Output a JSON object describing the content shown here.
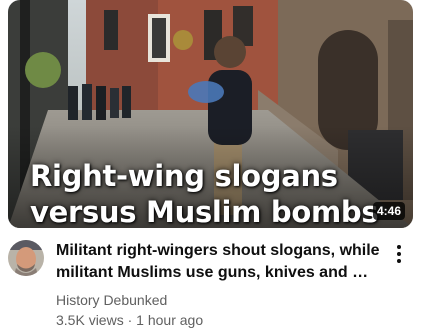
{
  "video": {
    "thumbnail_overlay_line1": "Right-wing slogans",
    "thumbnail_overlay_line2": "versus Muslim bombs",
    "duration": "4:46",
    "title": "Militant right-wingers shout slogans, while militant Muslims use guns, knives and …",
    "channel": "History Debunked",
    "views": "3.5K views",
    "separator": " · ",
    "age": "1 hour ago",
    "menu_icon": "more-vert-icon"
  },
  "colors": {
    "title": "#0f0f0f",
    "secondary_text": "#606060",
    "duration_bg": "#000000"
  }
}
